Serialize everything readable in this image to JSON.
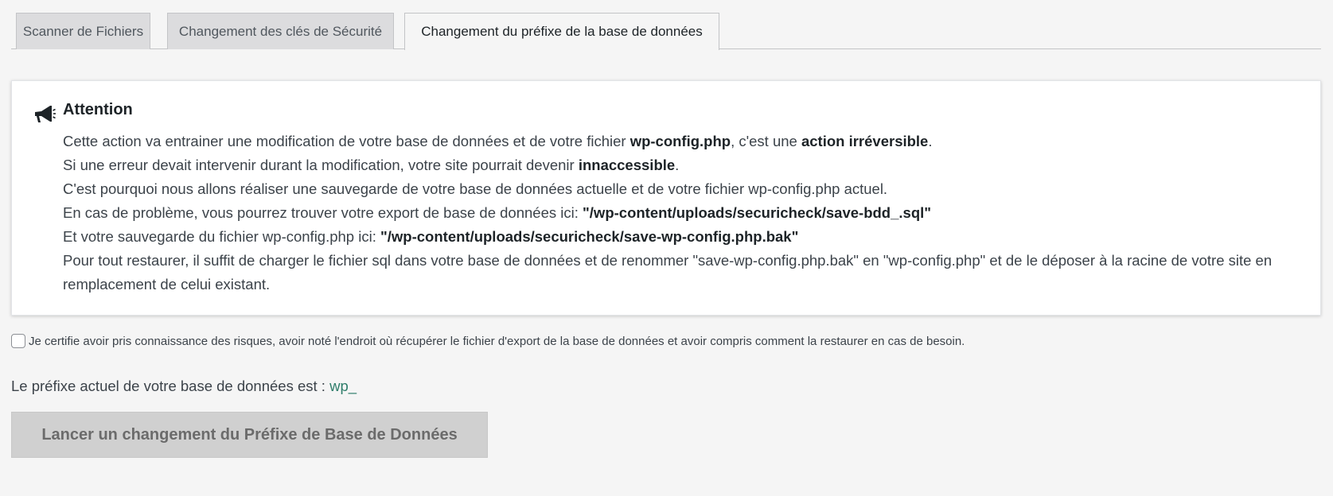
{
  "tabs": [
    {
      "label": "Scanner de Fichiers",
      "active": false
    },
    {
      "label": "Changement des clés de Sécurité",
      "active": false
    },
    {
      "label": "Changement du préfixe de la base de données",
      "active": true
    }
  ],
  "notice": {
    "icon": "megaphone-icon",
    "title": "Attention",
    "line1": {
      "a": "Cette action va entrainer une modification de votre base de données et de votre fichier ",
      "b": "wp-config.php",
      "c": ", c'est une ",
      "d": "action irréversible",
      "e": "."
    },
    "line2": {
      "a": "Si une erreur devait intervenir durant la modification, votre site pourrait devenir ",
      "b": "innaccessible",
      "c": "."
    },
    "line3": "C'est pourquoi nous allons réaliser une sauvegarde de votre base de données actuelle et de votre fichier wp-config.php actuel.",
    "line4": {
      "a": "En cas de problème, vous pourrez trouver votre export de base de données ici: ",
      "b": "\"/wp-content/uploads/securicheck/save-bdd_.sql\""
    },
    "line5": {
      "a": "Et votre sauvegarde du fichier wp-config.php ici: ",
      "b": "\"/wp-content/uploads/securicheck/save-wp-config.php.bak\""
    },
    "line6": "Pour tout restaurer, il suffit de charger le fichier sql dans votre base de données et de renommer \"save-wp-config.php.bak\" en \"wp-config.php\" et de le déposer à la racine de votre site en remplacement de celui existant."
  },
  "certify": {
    "label": "Je certifie avoir pris connaissance des risques, avoir noté l'endroit où récupérer le fichier d'export de la base de données et avoir compris comment la restaurer en cas de besoin.",
    "checked": false
  },
  "prefix": {
    "label": "Le préfixe actuel de votre base de données est : ",
    "value": "wp_"
  },
  "action_button": {
    "label": "Lancer un changement du Préfixe de Base de Données",
    "disabled": true
  },
  "colors": {
    "background": "#f5f5f5",
    "tab_inactive": "#dcdcde",
    "prefix_value": "#2e7d6a",
    "button_disabled": "#d0d0d0"
  }
}
